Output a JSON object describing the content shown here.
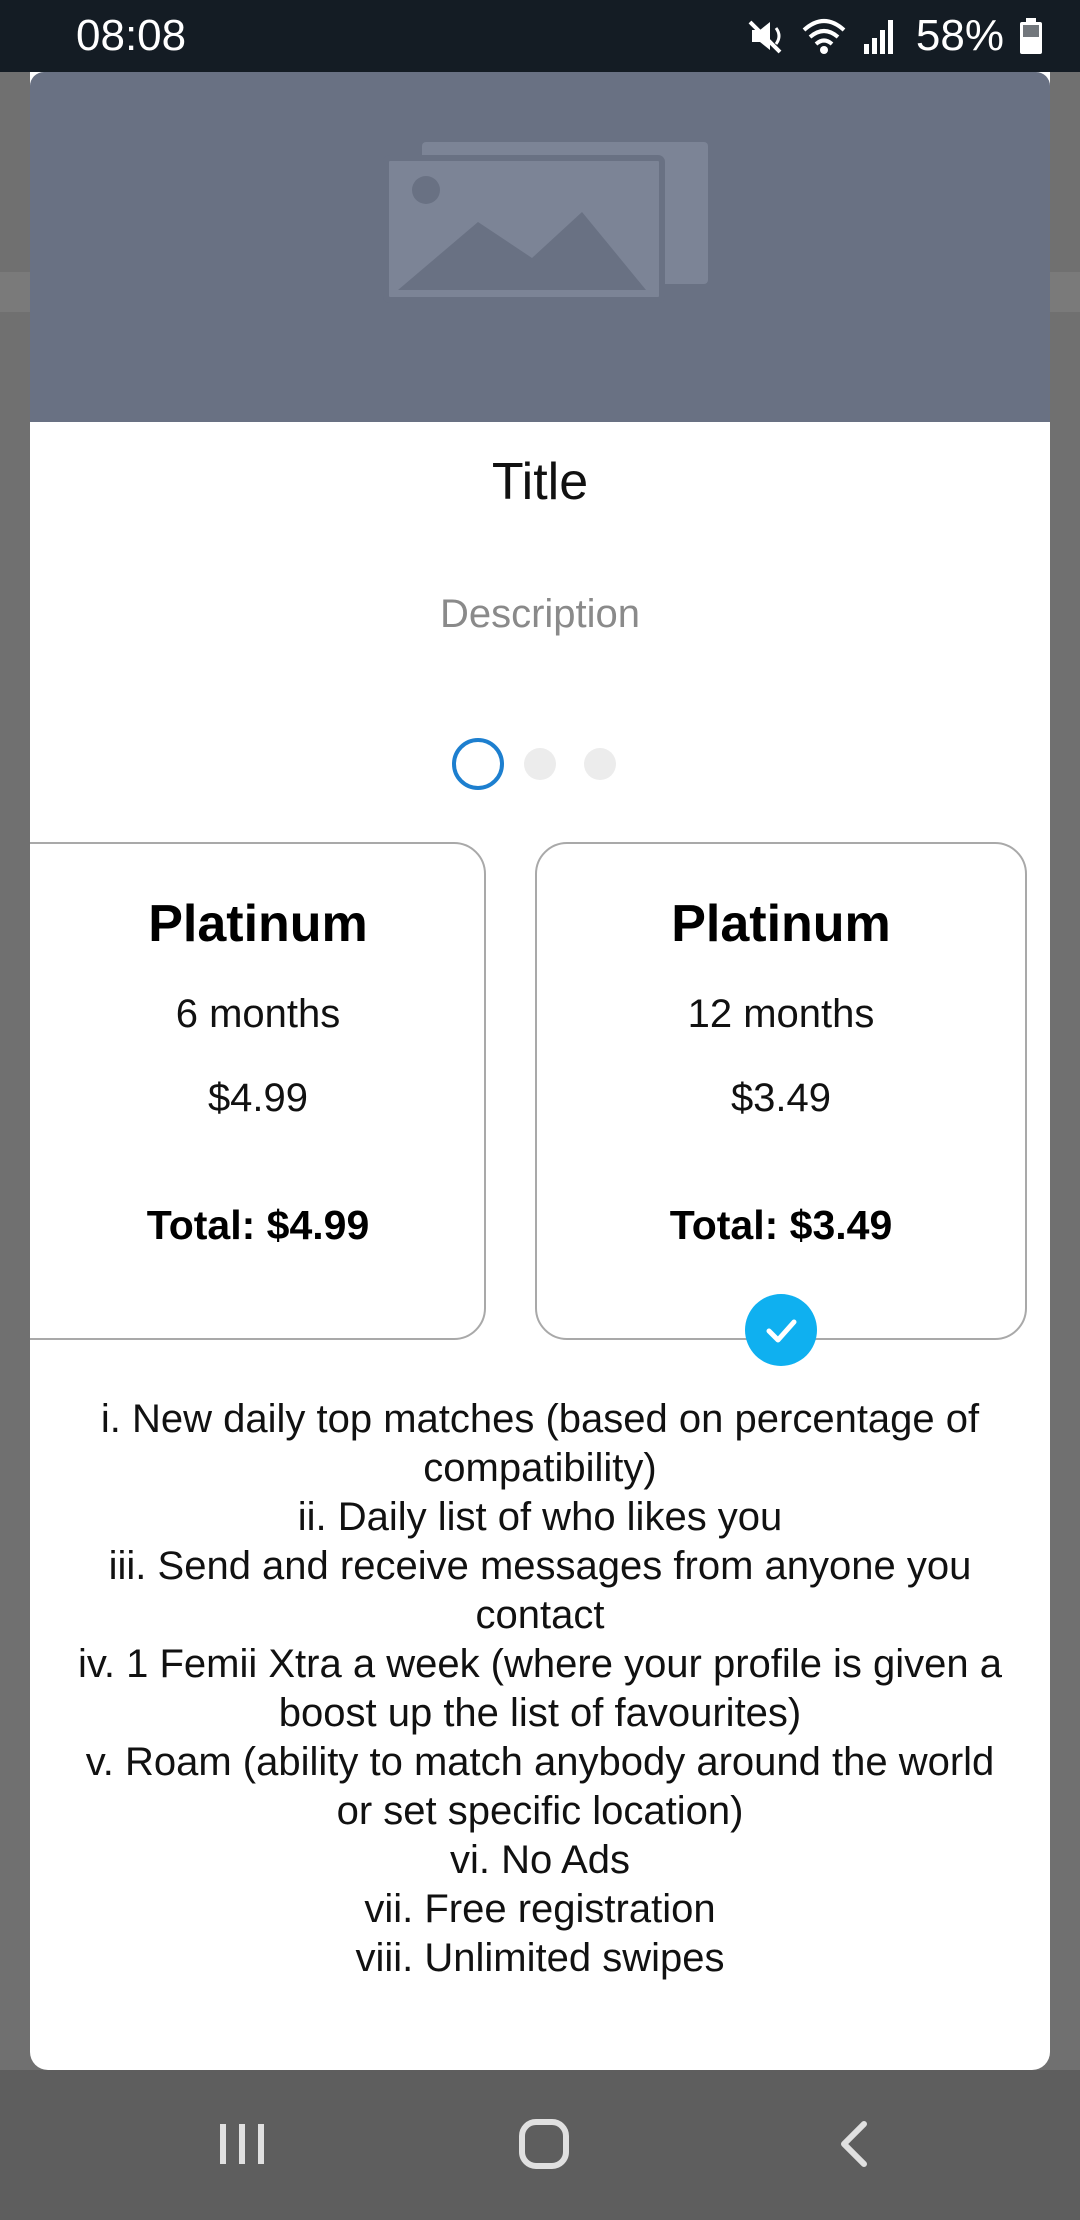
{
  "status_bar": {
    "time": "08:08",
    "battery": "58%",
    "icons": [
      "mute-vibrate-icon",
      "wifi-icon",
      "signal-icon",
      "battery-icon"
    ]
  },
  "dialog": {
    "hero_icon": "image-placeholder-icon",
    "title": "Title",
    "description": "Description",
    "pager": {
      "pages": 3,
      "active": 1
    },
    "plans": [
      {
        "name": "Platinum",
        "duration": "6 months",
        "price": "$4.99",
        "total": "Total: $4.99",
        "selected": false
      },
      {
        "name": "Platinum",
        "duration": "12 months",
        "price": "$3.49",
        "total": "Total: $3.49",
        "selected": true
      }
    ],
    "features": [
      "i. New daily top matches (based on percentage of compatibility)",
      "ii. Daily list of who likes you",
      "iii. Send and receive messages from anyone you contact",
      "iv. 1 Femii Xtra a week (where your profile is given a boost up the list of favourites)",
      "v. Roam (ability to match anybody around the world or set specific location)",
      "vi. No Ads",
      "vii. Free registration",
      "viii. Unlimited swipes"
    ]
  },
  "nav_bar": {
    "icons": [
      "recent-apps-icon",
      "home-icon",
      "back-icon"
    ]
  },
  "colors": {
    "accent": "#1d7fcf",
    "check": "#0fb0f0",
    "hero": "#697183",
    "status_bar": "#141c24"
  }
}
